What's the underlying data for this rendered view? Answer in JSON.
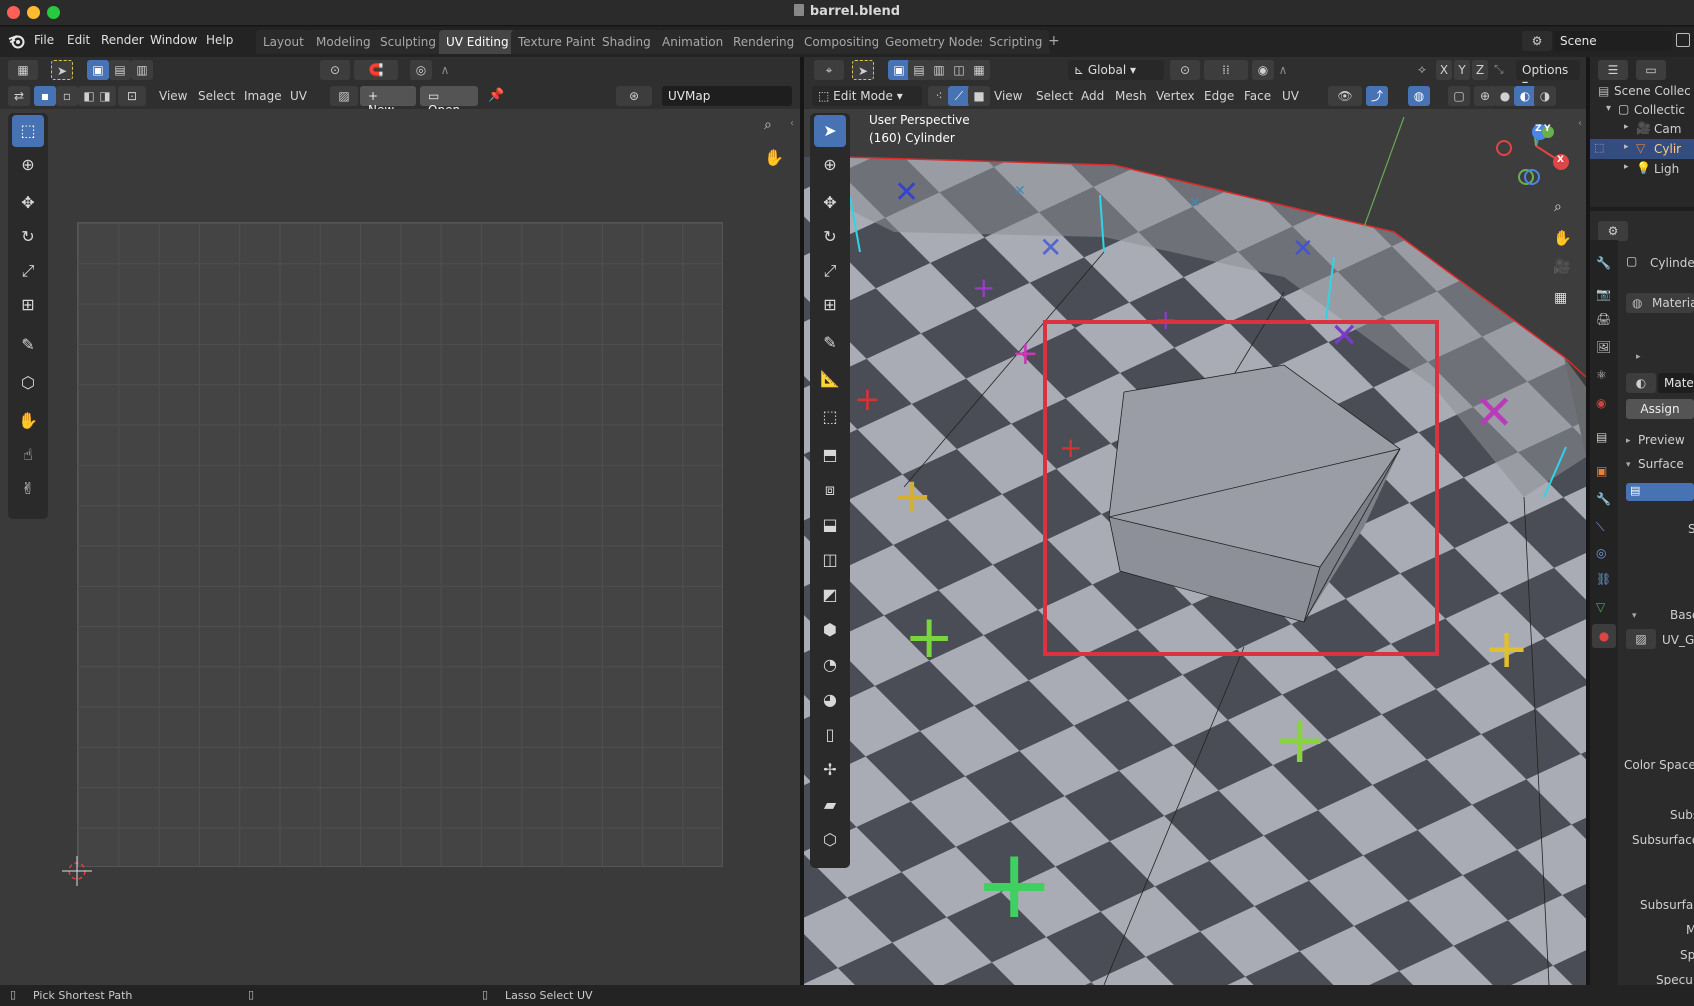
{
  "window": {
    "title": "barrel.blend"
  },
  "menu": [
    "File",
    "Edit",
    "Render",
    "Window",
    "Help"
  ],
  "workspaces": [
    {
      "label": "Layout",
      "active": false
    },
    {
      "label": "Modeling",
      "active": false
    },
    {
      "label": "Sculpting",
      "active": false
    },
    {
      "label": "UV Editing",
      "active": true
    },
    {
      "label": "Texture Paint",
      "active": false
    },
    {
      "label": "Shading",
      "active": false
    },
    {
      "label": "Animation",
      "active": false
    },
    {
      "label": "Rendering",
      "active": false
    },
    {
      "label": "Compositing",
      "active": false
    },
    {
      "label": "Geometry Nodes",
      "active": false
    },
    {
      "label": "Scripting",
      "active": false
    }
  ],
  "add_workspace": "+",
  "scene": {
    "label": "Scene"
  },
  "uv_editor": {
    "menus": [
      "View",
      "Select",
      "Image",
      "UV"
    ],
    "new_label": "New",
    "open_label": "Open",
    "uvmap_value": "UVMap"
  },
  "viewport": {
    "mode": "Edit Mode",
    "menus": [
      "View",
      "Select",
      "Add",
      "Mesh",
      "Vertex",
      "Edge",
      "Face",
      "UV"
    ],
    "orientation": "Global",
    "options_label": "Options",
    "axes": [
      "X",
      "Y",
      "Z"
    ],
    "overlay_line1": "User Perspective",
    "overlay_line2": "(160) Cylinder",
    "gizmo": {
      "x": "X",
      "y": "Y",
      "z": "Z"
    }
  },
  "outliner": {
    "root": "Scene Collec",
    "collection": "Collectic",
    "items": [
      "Cam",
      "Cylir",
      "Ligh"
    ]
  },
  "properties": {
    "object": "Cylinder",
    "material_slot": "Materia",
    "material_field": "Materi",
    "assign_label": "Assign",
    "preview_label": "Preview",
    "surface_label": "Surface",
    "base_label": "Base",
    "texture_name": "UV_Gr",
    "color_space_label": "Color Space",
    "subs_label": "Subs",
    "subsurface_l_label": "Subsurface l",
    "subsurface_label": "Subsurface",
    "m_label": "M",
    "s_label": "S",
    "sp_label": "Sp",
    "specul_label": "Specul"
  },
  "statusbar": {
    "left_hint": "Pick Shortest Path",
    "right_hint": "Lasso Select UV"
  },
  "colors": {
    "accent": "#4772b3",
    "highlight_box": "#d9333f",
    "seam": "#2fd4e6",
    "edge_red": "#d92b2b"
  }
}
